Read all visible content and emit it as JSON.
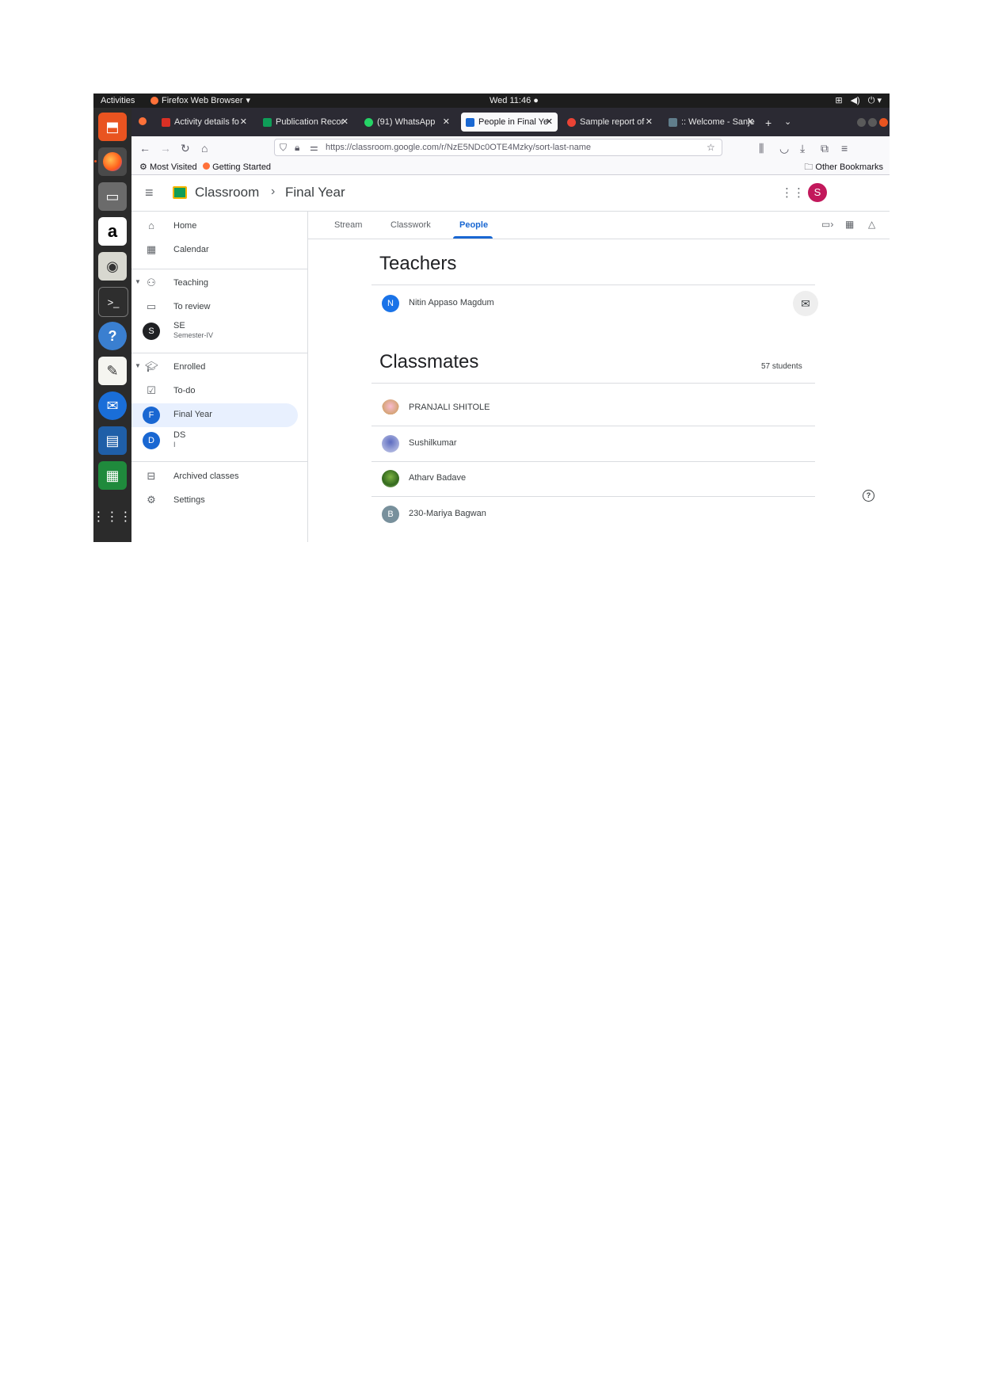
{
  "system": {
    "activities": "Activities",
    "app_name": "Firefox Web Browser",
    "clock": "Wed 11:46 ●"
  },
  "browser": {
    "tabs": [
      {
        "label": "Activity details fo",
        "favicon_color": "#d93025"
      },
      {
        "label": "Publication Recor",
        "favicon_color": "#0f9d58"
      },
      {
        "label": "(91) WhatsApp",
        "favicon_color": "#25d366"
      },
      {
        "label": "People in Final Ye",
        "favicon_color": "#1967d2"
      },
      {
        "label": "Sample report of",
        "favicon_color": "#ea4335"
      },
      {
        "label": ":: Welcome - Sanje",
        "favicon_color": "#607d8b"
      }
    ],
    "url": "https://classroom.google.com/r/NzE5NDc0OTE4Mzky/sort-last-name",
    "bookmarks": {
      "most_visited": "Most Visited",
      "getting_started": "Getting Started",
      "other": "Other Bookmarks"
    }
  },
  "header": {
    "app_title": "Classroom",
    "separator": "›",
    "class_title": "Final Year",
    "account_initial": "S"
  },
  "sidebar": {
    "home": "Home",
    "calendar": "Calendar",
    "teaching": "Teaching",
    "to_review": "To review",
    "teaching_class": {
      "initial": "S",
      "name": "SE",
      "section": "Semester-IV"
    },
    "enrolled": "Enrolled",
    "to_do": "To-do",
    "enrolled_classes": [
      {
        "initial": "F",
        "name": "Final Year",
        "section": ""
      },
      {
        "initial": "D",
        "name": "DS",
        "section": "I"
      }
    ],
    "archived": "Archived classes",
    "settings": "Settings"
  },
  "content": {
    "tabs": [
      "Stream",
      "Classwork",
      "People"
    ],
    "active_tab": "People",
    "teachers_heading": "Teachers",
    "teachers": [
      {
        "initial": "N",
        "name": "Nitin Appaso Magdum"
      }
    ],
    "classmates_heading": "Classmates",
    "student_count": "57 students",
    "classmates": [
      {
        "initial": "",
        "name": "PRANJALI SHITOLE"
      },
      {
        "initial": "",
        "name": "Sushilkumar"
      },
      {
        "initial": "",
        "name": "Atharv Badave"
      },
      {
        "initial": "B",
        "name": "230-Mariya Bagwan"
      }
    ],
    "help": "?"
  },
  "colors": {
    "accent": "#1967d2",
    "selected_bg": "#e8f0fe",
    "account_avatar": "#c2185b"
  }
}
